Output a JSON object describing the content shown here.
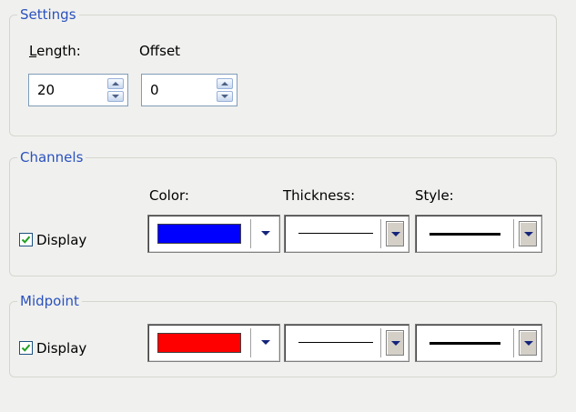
{
  "settings": {
    "title": "Settings",
    "length_label_ul": "L",
    "length_label_rest": "ength:",
    "length_value": "20",
    "offset_label": "Offset",
    "offset_value": "0"
  },
  "channels": {
    "title": "Channels",
    "color_label": "Color:",
    "thickness_label": "Thickness:",
    "style_label": "Style:",
    "display_label": "Display",
    "display_checked": true,
    "color": "#0000ff"
  },
  "midpoint": {
    "title": "Midpoint",
    "display_label": "Display",
    "display_checked": true,
    "color": "#ff0000"
  }
}
